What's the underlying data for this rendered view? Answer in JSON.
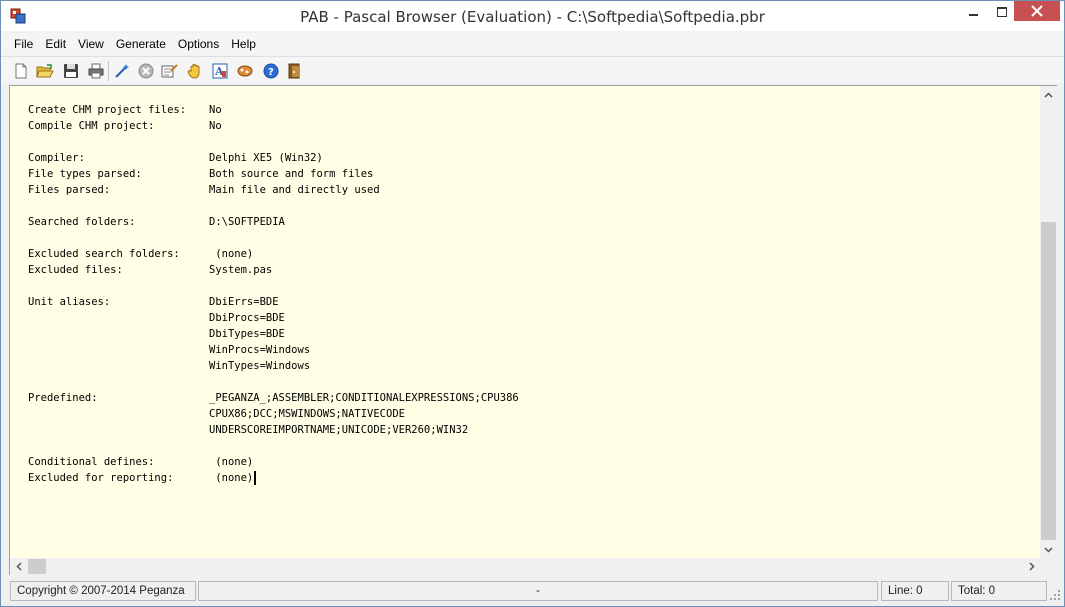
{
  "window": {
    "title": "PAB - Pascal Browser (Evaluation) - C:\\Softpedia\\Softpedia.pbr"
  },
  "menu": {
    "items": [
      "File",
      "Edit",
      "View",
      "Generate",
      "Options",
      "Help"
    ]
  },
  "toolbar": {
    "buttons": [
      {
        "icon": "new-document-icon"
      },
      {
        "icon": "open-folder-icon"
      },
      {
        "icon": "save-icon"
      },
      {
        "icon": "print-icon"
      },
      {
        "icon": "settings-wand-icon"
      },
      {
        "icon": "stop-icon"
      },
      {
        "icon": "edit-properties-icon"
      },
      {
        "icon": "generate-hand-icon"
      },
      {
        "icon": "font-icon"
      },
      {
        "icon": "tools-icon"
      },
      {
        "icon": "help-icon"
      },
      {
        "icon": "exit-icon"
      }
    ]
  },
  "content": {
    "lines": [
      {
        "label": "Create CHM project files:",
        "value": "No"
      },
      {
        "label": "Compile CHM project:",
        "value": "No"
      },
      {
        "label": "",
        "value": ""
      },
      {
        "label": "Compiler:",
        "value": "Delphi XE5 (Win32)"
      },
      {
        "label": "File types parsed:",
        "value": "Both source and form files"
      },
      {
        "label": "Files parsed:",
        "value": "Main file and directly used"
      },
      {
        "label": "",
        "value": ""
      },
      {
        "label": "Searched folders:",
        "value": "D:\\SOFTPEDIA"
      },
      {
        "label": "",
        "value": ""
      },
      {
        "label": "Excluded search folders:",
        "value": " (none)"
      },
      {
        "label": "Excluded files:",
        "value": "System.pas"
      },
      {
        "label": "",
        "value": ""
      },
      {
        "label": "Unit aliases:",
        "value": "DbiErrs=BDE"
      },
      {
        "label": "",
        "value": "DbiProcs=BDE"
      },
      {
        "label": "",
        "value": "DbiTypes=BDE"
      },
      {
        "label": "",
        "value": "WinProcs=Windows"
      },
      {
        "label": "",
        "value": "WinTypes=Windows"
      },
      {
        "label": "",
        "value": ""
      },
      {
        "label": "Predefined:",
        "value": "_PEGANZA_;ASSEMBLER;CONDITIONALEXPRESSIONS;CPU386"
      },
      {
        "label": "",
        "value": "CPUX86;DCC;MSWINDOWS;NATIVECODE"
      },
      {
        "label": "",
        "value": "UNDERSCOREIMPORTNAME;UNICODE;VER260;WIN32"
      },
      {
        "label": "",
        "value": ""
      },
      {
        "label": "Conditional defines:",
        "value": " (none)"
      },
      {
        "label": "Excluded for reporting:",
        "value": " (none)"
      }
    ]
  },
  "status": {
    "copyright": "Copyright © 2007-2014 Peganza",
    "middle": "-",
    "line": "Line: 0",
    "total": "Total: 0"
  }
}
